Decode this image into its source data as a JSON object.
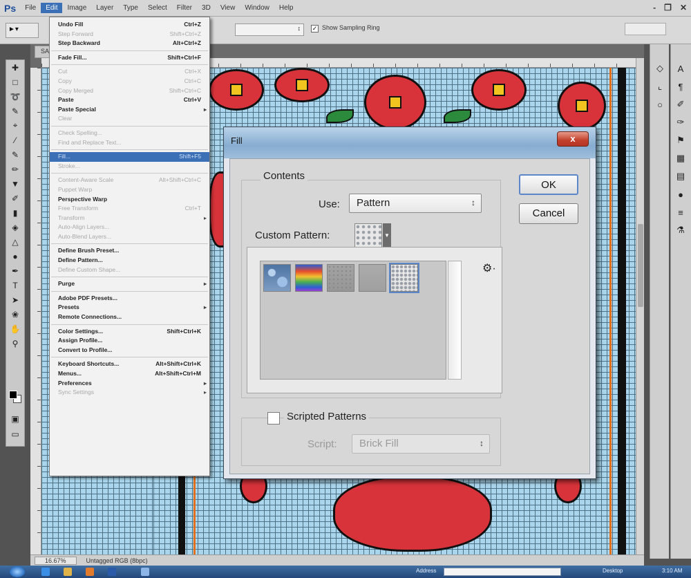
{
  "app": {
    "logo": "Ps",
    "menus": [
      "File",
      "Edit",
      "Image",
      "Layer",
      "Type",
      "Select",
      "Filter",
      "3D",
      "View",
      "Window",
      "Help"
    ],
    "window_controls": [
      "-",
      "❐",
      "✕"
    ]
  },
  "options_bar": {
    "show_sampling_ring_label": "Show Sampling Ring",
    "show_sampling_ring_checked": true
  },
  "document": {
    "tab_label": "SAMU* ×",
    "zoom": "16.67%",
    "status": "Untagged RGB (8bpc)"
  },
  "edit_menu": {
    "items": [
      {
        "label": "Undo Fill",
        "shortcut": "Ctrl+Z",
        "state": "bold"
      },
      {
        "label": "Step Forward",
        "shortcut": "Shift+Ctrl+Z",
        "state": "disabled"
      },
      {
        "label": "Step Backward",
        "shortcut": "Alt+Ctrl+Z",
        "state": "bold"
      },
      {
        "sep": true
      },
      {
        "label": "Fade Fill...",
        "shortcut": "Shift+Ctrl+F",
        "state": "bold"
      },
      {
        "sep": true
      },
      {
        "label": "Cut",
        "shortcut": "Ctrl+X",
        "state": "disabled"
      },
      {
        "label": "Copy",
        "shortcut": "Ctrl+C",
        "state": "disabled"
      },
      {
        "label": "Copy Merged",
        "shortcut": "Shift+Ctrl+C",
        "state": "disabled"
      },
      {
        "label": "Paste",
        "shortcut": "Ctrl+V",
        "state": "bold"
      },
      {
        "label": "Paste Special",
        "shortcut": "",
        "state": "bold",
        "submenu": true
      },
      {
        "label": "Clear",
        "shortcut": "",
        "state": "disabled"
      },
      {
        "sep": true
      },
      {
        "label": "Check Spelling...",
        "shortcut": "",
        "state": "disabled"
      },
      {
        "label": "Find and Replace Text...",
        "shortcut": "",
        "state": "disabled"
      },
      {
        "sep": true
      },
      {
        "label": "Fill...",
        "shortcut": "Shift+F5",
        "state": "highlight"
      },
      {
        "label": "Stroke...",
        "shortcut": "",
        "state": "disabled"
      },
      {
        "sep": true
      },
      {
        "label": "Content-Aware Scale",
        "shortcut": "Alt+Shift+Ctrl+C",
        "state": "disabled"
      },
      {
        "label": "Puppet Warp",
        "shortcut": "",
        "state": "disabled"
      },
      {
        "label": "Perspective Warp",
        "shortcut": "",
        "state": "bold"
      },
      {
        "label": "Free Transform",
        "shortcut": "Ctrl+T",
        "state": "disabled"
      },
      {
        "label": "Transform",
        "shortcut": "",
        "state": "disabled",
        "submenu": true
      },
      {
        "label": "Auto-Align Layers...",
        "shortcut": "",
        "state": "disabled"
      },
      {
        "label": "Auto-Blend Layers...",
        "shortcut": "",
        "state": "disabled"
      },
      {
        "sep": true
      },
      {
        "label": "Define Brush Preset...",
        "shortcut": "",
        "state": "bold"
      },
      {
        "label": "Define Pattern...",
        "shortcut": "",
        "state": "bold"
      },
      {
        "label": "Define Custom Shape...",
        "shortcut": "",
        "state": "disabled"
      },
      {
        "sep": true
      },
      {
        "label": "Purge",
        "shortcut": "",
        "state": "bold",
        "submenu": true
      },
      {
        "sep": true
      },
      {
        "label": "Adobe PDF Presets...",
        "shortcut": "",
        "state": "bold"
      },
      {
        "label": "Presets",
        "shortcut": "",
        "state": "bold",
        "submenu": true
      },
      {
        "label": "Remote Connections...",
        "shortcut": "",
        "state": "bold"
      },
      {
        "sep": true
      },
      {
        "label": "Color Settings...",
        "shortcut": "Shift+Ctrl+K",
        "state": "bold"
      },
      {
        "label": "Assign Profile...",
        "shortcut": "",
        "state": "bold"
      },
      {
        "label": "Convert to Profile...",
        "shortcut": "",
        "state": "bold"
      },
      {
        "sep": true
      },
      {
        "label": "Keyboard Shortcuts...",
        "shortcut": "Alt+Shift+Ctrl+K",
        "state": "bold"
      },
      {
        "label": "Menus...",
        "shortcut": "Alt+Shift+Ctrl+M",
        "state": "bold"
      },
      {
        "label": "Preferences",
        "shortcut": "",
        "state": "bold",
        "submenu": true
      },
      {
        "label": "Sync Settings",
        "shortcut": "",
        "state": "disabled",
        "submenu": true
      }
    ]
  },
  "fill_dialog": {
    "title": "Fill",
    "close_label": "x",
    "contents_label": "Contents",
    "use_label": "Use:",
    "use_value": "Pattern",
    "custom_pattern_label": "Custom Pattern:",
    "ok_label": "OK",
    "cancel_label": "Cancel",
    "scripted_patterns_label": "Scripted Patterns",
    "scripted_patterns_checked": false,
    "script_label": "Script:",
    "script_value": "Brick Fill",
    "patterns": [
      {
        "name": "bubbles",
        "color": "#5f86b2"
      },
      {
        "name": "tie-dye",
        "color": "#e8a23a"
      },
      {
        "name": "gray-granite",
        "color": "#9a9a9a"
      },
      {
        "name": "gray-paper",
        "color": "#a6a6a6"
      },
      {
        "name": "custom-dots",
        "color": "#e6e6e6"
      }
    ]
  },
  "taskbar": {
    "address_label": "Address",
    "desktop_label": "Desktop",
    "time": "3:10 AM"
  }
}
